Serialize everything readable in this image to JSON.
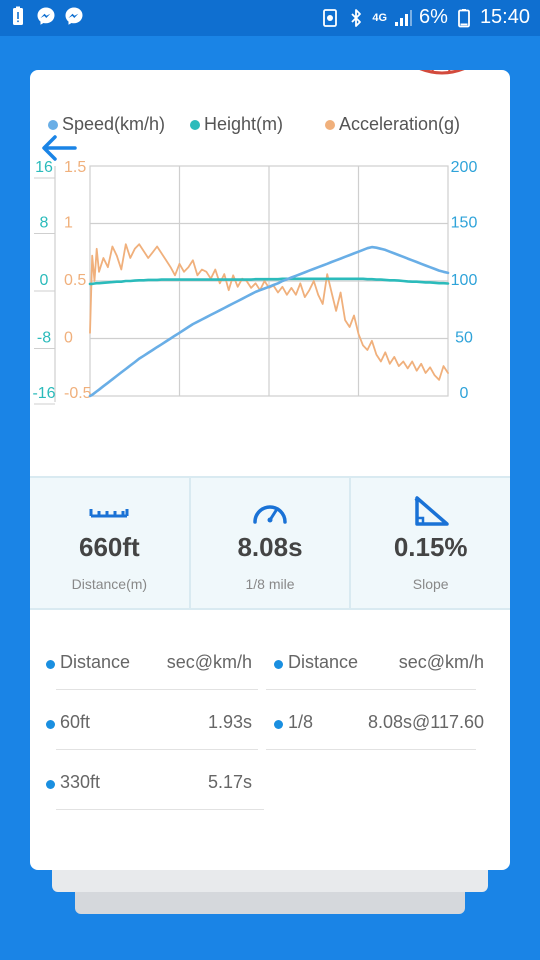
{
  "status_bar": {
    "network": "4G",
    "battery": "6%",
    "time": "15:40"
  },
  "legend": [
    {
      "label": "Speed(km/h)",
      "color": "#69aee6"
    },
    {
      "label": "Height(m)",
      "color": "#2bbbbb"
    },
    {
      "label": "Acceleration(g)",
      "color": "#f0b07c"
    }
  ],
  "stats": [
    {
      "value": "660ft",
      "label": "Distance(m)",
      "icon": "ruler-icon"
    },
    {
      "value": "8.08s",
      "label": "1/8 mile",
      "icon": "speedometer-icon"
    },
    {
      "value": "0.15%",
      "label": "Slope",
      "icon": "slope-icon"
    }
  ],
  "results": {
    "left_header": {
      "name": "Distance",
      "value": "sec@km/h"
    },
    "right_header": {
      "name": "Distance",
      "value": "sec@km/h"
    },
    "left_rows": [
      {
        "name": "60ft",
        "value": "1.93s"
      },
      {
        "name": "330ft",
        "value": "5.17s"
      }
    ],
    "right_rows": [
      {
        "name": "1/8",
        "value": "8.08s@117.60"
      }
    ]
  },
  "chart_data": {
    "type": "line",
    "title": "",
    "axes": {
      "height": {
        "ticks": [
          "16",
          "8",
          "0",
          "-8",
          "-16"
        ],
        "range": [
          -16,
          16
        ],
        "color": "#2bbbbb"
      },
      "acceleration": {
        "ticks": [
          "1.5",
          "1",
          "0.5",
          "0",
          "-0.5"
        ],
        "range": [
          -0.5,
          1.5
        ],
        "color": "#f0b07c"
      },
      "speed": {
        "ticks": [
          "200",
          "150",
          "100",
          "50",
          "0"
        ],
        "range": [
          0,
          200
        ],
        "color": "#2fa3d9"
      }
    },
    "x": [
      0,
      0.25,
      0.5,
      0.75,
      1.0,
      1.5,
      2,
      2.5,
      3,
      3.5,
      4,
      4.5,
      5,
      5.5,
      6,
      6.5,
      7,
      7.5,
      8,
      8.5,
      9,
      9.5,
      10,
      10.5,
      11,
      11.5,
      12,
      12.5,
      13,
      13.5,
      14,
      14.5,
      15,
      15.5,
      16,
      16.5,
      17,
      17.5,
      18,
      18.5,
      19,
      19.5,
      20,
      20.5,
      21,
      21.5,
      22,
      22.5,
      23,
      23.5,
      24,
      24.5,
      25,
      25.5,
      26,
      26.5,
      27,
      27.5,
      28,
      28.5,
      29,
      29.5,
      30,
      30.5,
      31,
      31.5,
      32,
      32.5,
      33,
      33.5,
      34,
      34.5,
      35,
      35.5,
      36,
      36.5,
      37,
      37.5,
      38,
      38.5,
      39,
      39.5,
      40
    ],
    "series": [
      {
        "name": "Speed(km/h)",
        "axis": "speed",
        "color": "#69aee6",
        "values": [
          0,
          1,
          2.5,
          4,
          5.5,
          8.5,
          11.5,
          14.5,
          17.5,
          20.5,
          23.5,
          26.5,
          29.5,
          32.5,
          35,
          37.5,
          40,
          42.5,
          45,
          47.5,
          50,
          52.5,
          55,
          57.5,
          60,
          62.5,
          64.5,
          66.5,
          68.5,
          70.5,
          72.5,
          74.5,
          76.5,
          78.5,
          80.5,
          82.5,
          84.5,
          86.5,
          88.5,
          90.5,
          92,
          93.5,
          95,
          96.5,
          98,
          100,
          101.5,
          103,
          104.5,
          106,
          107.5,
          109,
          110.5,
          112,
          113.5,
          115,
          116.5,
          118,
          119.5,
          121,
          122.5,
          124,
          125.5,
          127,
          128.5,
          129.5,
          129,
          128,
          127,
          125.5,
          124,
          122.5,
          121,
          119.5,
          118,
          116.5,
          115,
          113.5,
          112,
          110.5,
          109,
          108,
          107
        ]
      },
      {
        "name": "Height(m)",
        "axis": "height",
        "color": "#2bbbbb",
        "values": [
          -0.4,
          -0.4,
          -0.35,
          -0.3,
          -0.3,
          -0.25,
          -0.2,
          -0.15,
          -0.1,
          -0.1,
          0,
          0,
          0.05,
          0.1,
          0.1,
          0.15,
          0.15,
          0.15,
          0.2,
          0.2,
          0.2,
          0.2,
          0.2,
          0.2,
          0.2,
          0.2,
          0.2,
          0.2,
          0.2,
          0.2,
          0.2,
          0.2,
          0.2,
          0.2,
          0.2,
          0.2,
          0.2,
          0.2,
          0.2,
          0.25,
          0.25,
          0.25,
          0.25,
          0.25,
          0.25,
          0.3,
          0.3,
          0.3,
          0.3,
          0.3,
          0.3,
          0.3,
          0.3,
          0.3,
          0.3,
          0.3,
          0.3,
          0.3,
          0.3,
          0.3,
          0.3,
          0.3,
          0.3,
          0.3,
          0.25,
          0.25,
          0.2,
          0.2,
          0.15,
          0.1,
          0.1,
          0.05,
          0,
          -0.05,
          -0.1,
          -0.1,
          -0.15,
          -0.2,
          -0.2,
          -0.25,
          -0.3,
          -0.3,
          -0.35
        ]
      },
      {
        "name": "Acceleration(g)",
        "axis": "acceleration",
        "color": "#f0b07c",
        "values": [
          0.05,
          0.72,
          0.5,
          0.78,
          0.58,
          0.7,
          0.62,
          0.8,
          0.72,
          0.6,
          0.82,
          0.7,
          0.78,
          0.82,
          0.76,
          0.7,
          0.75,
          0.8,
          0.74,
          0.68,
          0.62,
          0.55,
          0.65,
          0.58,
          0.62,
          0.68,
          0.55,
          0.6,
          0.58,
          0.52,
          0.6,
          0.48,
          0.56,
          0.42,
          0.55,
          0.45,
          0.52,
          0.5,
          0.44,
          0.48,
          0.42,
          0.5,
          0.44,
          0.46,
          0.4,
          0.45,
          0.38,
          0.44,
          0.38,
          0.48,
          0.36,
          0.42,
          0.5,
          0.38,
          0.3,
          0.56,
          0.4,
          0.24,
          0.4,
          0.16,
          0.1,
          0.2,
          0.04,
          -0.06,
          -0.1,
          -0.02,
          -0.14,
          -0.2,
          -0.12,
          -0.22,
          -0.16,
          -0.24,
          -0.2,
          -0.26,
          -0.2,
          -0.28,
          -0.22,
          -0.3,
          -0.25,
          -0.32,
          -0.36,
          -0.24,
          -0.3
        ]
      }
    ],
    "grid": true,
    "legend_position": "top"
  }
}
